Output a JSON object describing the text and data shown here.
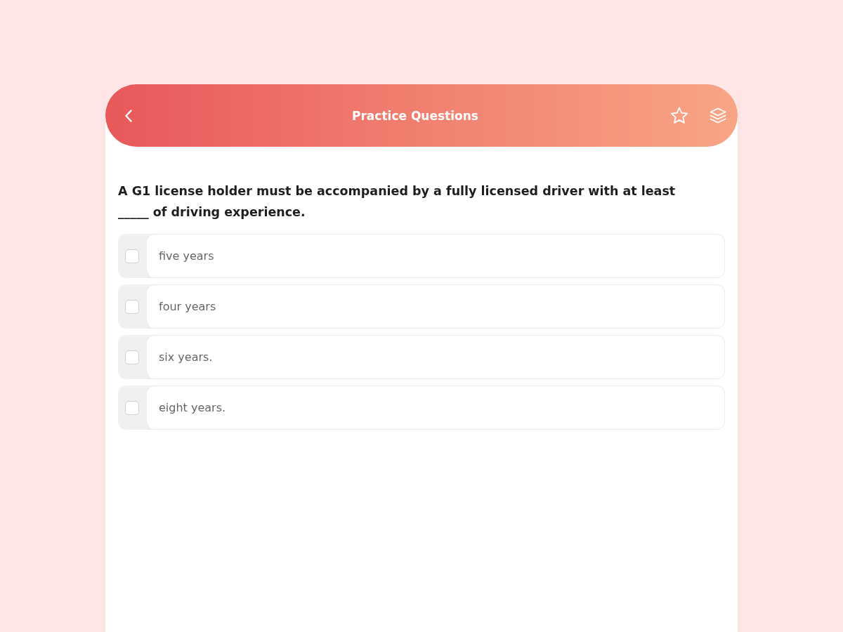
{
  "header": {
    "title": "Practice Questions"
  },
  "question": {
    "text": "A G1 license holder must be accompanied by a fully licensed driver with at least _____ of driving experience."
  },
  "options": [
    {
      "label": "five years",
      "checked": false
    },
    {
      "label": "four years",
      "checked": false
    },
    {
      "label": "six years.",
      "checked": false
    },
    {
      "label": "eight years.",
      "checked": false
    }
  ]
}
